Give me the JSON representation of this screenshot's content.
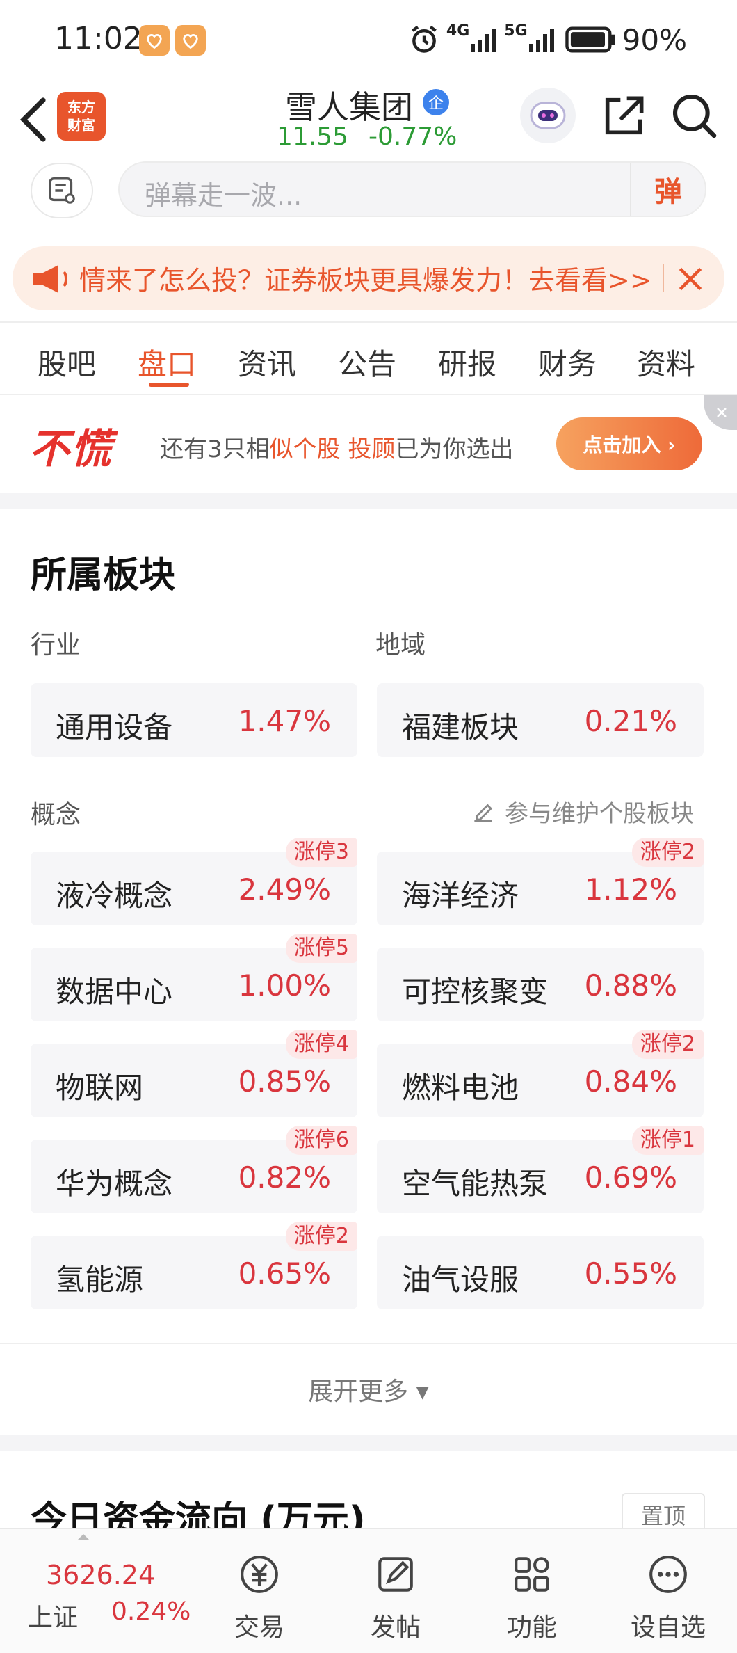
{
  "status_bar": {
    "time": "11:02",
    "battery": "90%",
    "net1": "4G",
    "net2": "5G"
  },
  "header": {
    "stock_name": "雪人集团",
    "badge": "企",
    "price": "11.55",
    "change": "-0.77%",
    "logo_line1": "东方",
    "logo_line2": "财富"
  },
  "danmaku": {
    "placeholder": "弹幕走一波...",
    "button": "弹"
  },
  "banner": {
    "text": "情来了怎么投？证券板块更具爆发力！去看看>>"
  },
  "tabs": [
    "股吧",
    "盘口",
    "资讯",
    "公告",
    "研报",
    "财务",
    "资料"
  ],
  "ad": {
    "logo": "不慌",
    "text_prefix": "还有3只相",
    "text_hl1": "似个股 投顾",
    "text_suffix": "已为你选出",
    "button": "点击加入 ›"
  },
  "sectors": {
    "title": "所属板块",
    "industry_label": "行业",
    "region_label": "地域",
    "concept_label": "概念",
    "maintain_link": "参与维护个股板块",
    "industry": {
      "name": "通用设备",
      "pct": "1.47%"
    },
    "region": {
      "name": "福建板块",
      "pct": "0.21%"
    },
    "concepts": [
      {
        "name": "液冷概念",
        "pct": "2.49%",
        "limit": "涨停3"
      },
      {
        "name": "海洋经济",
        "pct": "1.12%",
        "limit": "涨停2"
      },
      {
        "name": "数据中心",
        "pct": "1.00%",
        "limit": "涨停5"
      },
      {
        "name": "可控核聚变",
        "pct": "0.88%",
        "limit": ""
      },
      {
        "name": "物联网",
        "pct": "0.85%",
        "limit": "涨停4"
      },
      {
        "name": "燃料电池",
        "pct": "0.84%",
        "limit": "涨停2"
      },
      {
        "name": "华为概念",
        "pct": "0.82%",
        "limit": "涨停6"
      },
      {
        "name": "空气能热泵",
        "pct": "0.69%",
        "limit": "涨停1"
      },
      {
        "name": "氢能源",
        "pct": "0.65%",
        "limit": "涨停2"
      },
      {
        "name": "油气设服",
        "pct": "0.55%",
        "limit": ""
      }
    ],
    "expand": "展开更多 ▾"
  },
  "flow": {
    "title": "今日资金流向 (万元)",
    "pin": "置顶"
  },
  "bottom_bar": {
    "index_value": "3626.24",
    "index_name": "上证",
    "index_pct": "0.24%",
    "items": [
      "交易",
      "发帖",
      "功能",
      "设自选"
    ]
  },
  "colors": {
    "accent": "#e8552c",
    "up": "#d9363e",
    "down": "#2c9b35"
  }
}
